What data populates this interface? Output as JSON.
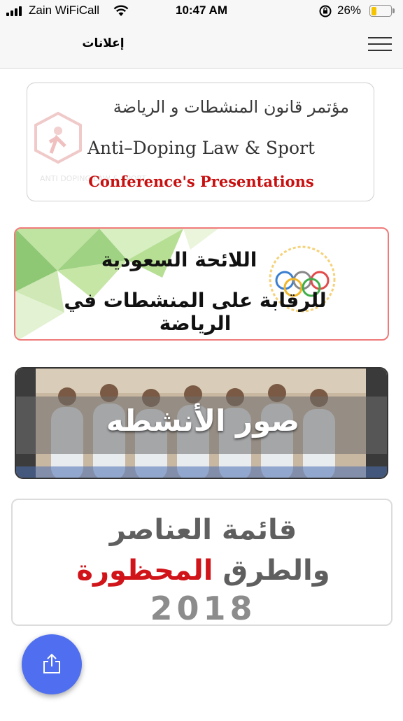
{
  "status_bar": {
    "carrier": "Zain WiFiCall",
    "time": "10:47 AM",
    "battery_percent": "26%",
    "battery_level": 0.26,
    "battery_color": "#f5c400",
    "icons": [
      "signal-icon",
      "wifi-icon",
      "rotation-lock-icon",
      "battery-icon"
    ]
  },
  "nav": {
    "title": "إعلانات",
    "menu_icon": "hamburger-menu-icon"
  },
  "cards": [
    {
      "arabic_title": "مؤتمر قانون المنشطات و الرياضة",
      "english_title": "Anti–Doping Law & Sport",
      "subtitle": "Conference's Presentations",
      "watermark": "ANTI DOPING LAW & SPORT"
    },
    {
      "line1": "اللائحة السعودية",
      "line2": "للرقابة على المنشطات في الرياضة",
      "accent_color": "#f07a7a"
    },
    {
      "title": "صور الأنشطه"
    },
    {
      "line1": "قائمة العناصر",
      "line2_gray": "والطرق",
      "line2_red": "المحظورة",
      "year": "2018",
      "red_color": "#d01419"
    }
  ],
  "share_button": {
    "icon": "share-icon",
    "color": "#4f6ff0"
  }
}
